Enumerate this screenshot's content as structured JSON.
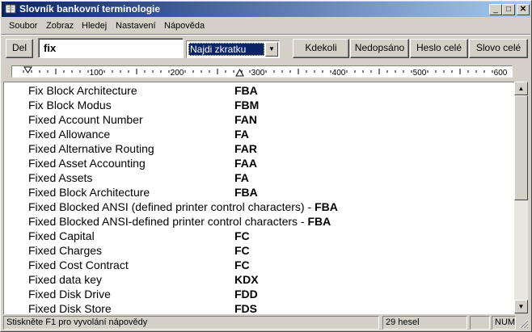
{
  "window": {
    "title": "Slovník bankovní terminologie",
    "controls": {
      "minimize": "_",
      "maximize": "□",
      "close": "✕"
    }
  },
  "menu": [
    "Soubor",
    "Zobraz",
    "Hledej",
    "Nastavení",
    "Nápověda"
  ],
  "toolbar": {
    "del_label": "Del",
    "search_value": "fix",
    "search_mode": "Najdi zkratku",
    "buttons": [
      "Kdekoli",
      "Nedopsáno",
      "Heslo celé",
      "Slovo celé"
    ]
  },
  "ruler": {
    "labels": [
      "100",
      "200",
      "300",
      "400",
      "500",
      "600"
    ]
  },
  "entries": [
    {
      "term": "Fix Block Architecture",
      "abbr": "FBA"
    },
    {
      "term": "Fix Block Modus",
      "abbr": "FBM"
    },
    {
      "term": "Fixed Account Number",
      "abbr": "FAN"
    },
    {
      "term": "Fixed Allowance",
      "abbr": "FA"
    },
    {
      "term": "Fixed Alternative Routing",
      "abbr": "FAR"
    },
    {
      "term": "Fixed Asset Accounting",
      "abbr": "FAA"
    },
    {
      "term": "Fixed Assets",
      "abbr": "FA"
    },
    {
      "term": "Fixed Block Architecture",
      "abbr": "FBA"
    },
    {
      "term": "Fixed Blocked ANSI (defined printer control characters) - ",
      "inline_abbr": "FBA"
    },
    {
      "term": "Fixed Blocked ANSI-defined printer control characters - ",
      "inline_abbr": "FBA"
    },
    {
      "term": "Fixed Capital",
      "abbr": "FC"
    },
    {
      "term": "Fixed Charges",
      "abbr": "FC"
    },
    {
      "term": "Fixed Cost Contract",
      "abbr": "FC"
    },
    {
      "term": "Fixed data key",
      "abbr": "KDX"
    },
    {
      "term": "Fixed Disk Drive",
      "abbr": "FDD"
    },
    {
      "term": "Fixed Disk Store",
      "abbr": "FDS"
    }
  ],
  "status": {
    "help": "Stiskněte F1 pro vyvolání nápovědy",
    "count": "29 hesel",
    "num": "NUM"
  }
}
